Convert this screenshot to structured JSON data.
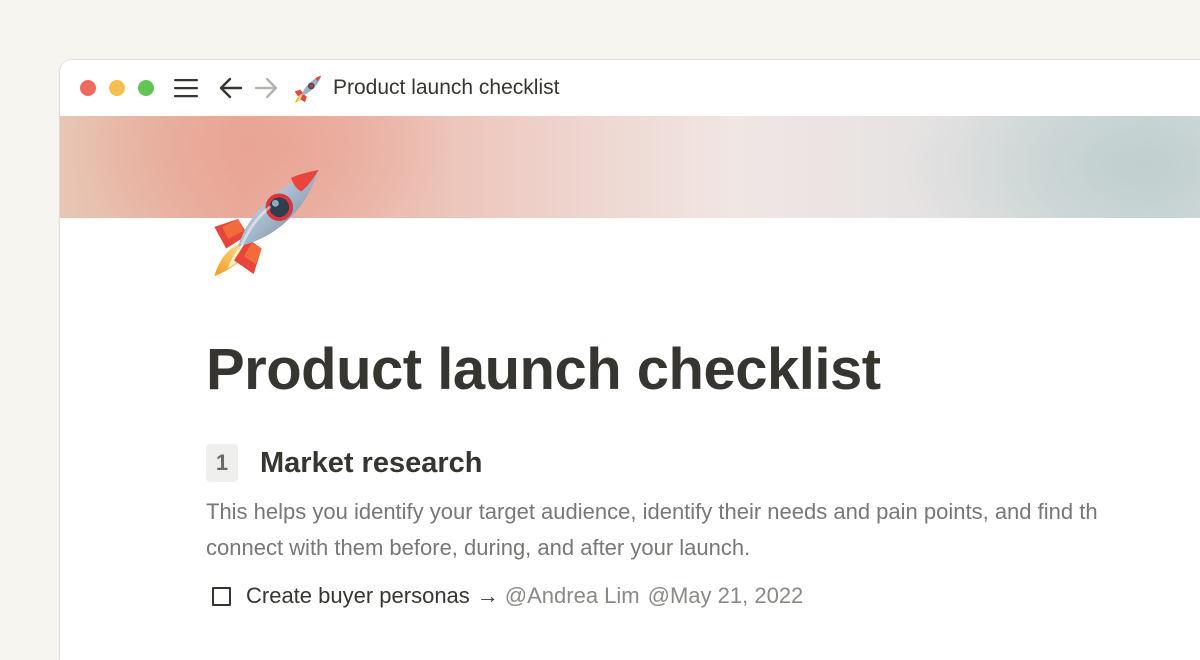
{
  "window": {
    "title": "Product launch checklist",
    "title_icon": "rocket-emoji",
    "nav": {
      "menu_icon": "hamburger-menu-icon",
      "back_icon": "arrow-left-icon",
      "forward_icon": "arrow-right-icon"
    },
    "traffic_lights": [
      "#ed6a5e",
      "#f5bf4f",
      "#62c554"
    ]
  },
  "page": {
    "icon": "rocket-emoji",
    "title": "Product launch checklist",
    "sections": [
      {
        "number": "1",
        "heading": "Market research",
        "description_lines": [
          "This helps you identify your target audience, identify their needs and pain points, and find th",
          "connect with them before, during, and after your launch."
        ],
        "todos": [
          {
            "label": "Create buyer personas",
            "arrow": "→",
            "assignee": "@Andrea Lim",
            "date": "@May 21, 2022",
            "checked": false
          }
        ]
      }
    ]
  },
  "colors": {
    "background": "#f7f5f0",
    "text": "#37352f",
    "muted_text": "#787774",
    "mention_text": "#8a8984"
  }
}
